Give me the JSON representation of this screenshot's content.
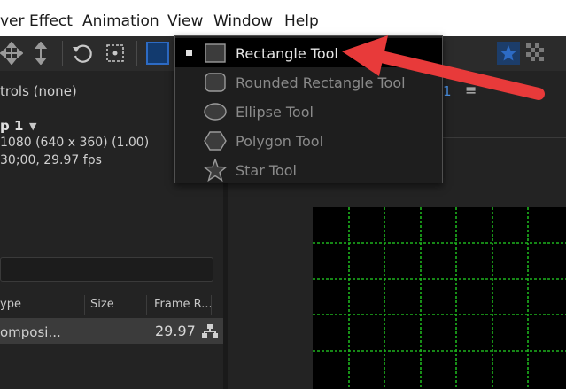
{
  "menubar": {
    "items": [
      "ver",
      "Effect",
      "Animation",
      "View",
      "Window",
      "Help"
    ]
  },
  "left_panel": {
    "controls_label": "trols (none)",
    "comp_name": "p 1",
    "comp_dims": "1080  (640 x 360) (1.00)",
    "comp_duration": "30;00, 29.97 fps",
    "columns": [
      "ype",
      "Size",
      "Frame R..."
    ],
    "row": {
      "type": "omposi...",
      "frame_rate": "29.97"
    }
  },
  "right_panel": {
    "fragment": "1"
  },
  "dropdown": {
    "items": [
      {
        "label": "Rectangle Tool",
        "icon": "rectangle-icon",
        "selected": true
      },
      {
        "label": "Rounded Rectangle Tool",
        "icon": "rounded-rectangle-icon",
        "selected": false
      },
      {
        "label": "Ellipse Tool",
        "icon": "ellipse-icon",
        "selected": false
      },
      {
        "label": "Polygon Tool",
        "icon": "polygon-icon",
        "selected": false
      },
      {
        "label": "Star Tool",
        "icon": "star-icon",
        "selected": false
      }
    ]
  },
  "colors": {
    "annotation_arrow": "#e83a3a",
    "grid_line": "#1db31d",
    "accent_blue": "#2d6bc4"
  }
}
